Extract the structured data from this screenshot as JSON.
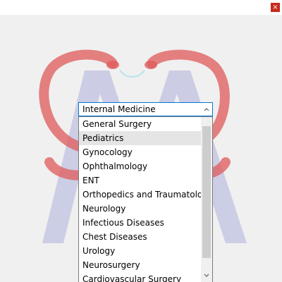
{
  "window": {
    "close_glyph": "×",
    "close_color": "#c42b1c"
  },
  "logo": {
    "snake_color": "#e05a5a",
    "letter_color": "#8a8fd0"
  },
  "specialty_select": {
    "selected_value": "Internal Medicine",
    "accent_color": "#0078d7",
    "icons": {
      "up": "chevron-up-icon",
      "down": "chevron-down-icon"
    },
    "hovered_index": 1,
    "scroll_position": 0.1,
    "options": [
      "General Surgery",
      "Pediatrics",
      "Gynocology",
      "Ophthalmology",
      "ENT",
      "Orthopedics and Traumatology",
      "Neurology",
      "Infectious Diseases",
      "Chest Diseases",
      "Urology",
      "Neurosurgery",
      "Cardiovascular Surgery"
    ]
  }
}
